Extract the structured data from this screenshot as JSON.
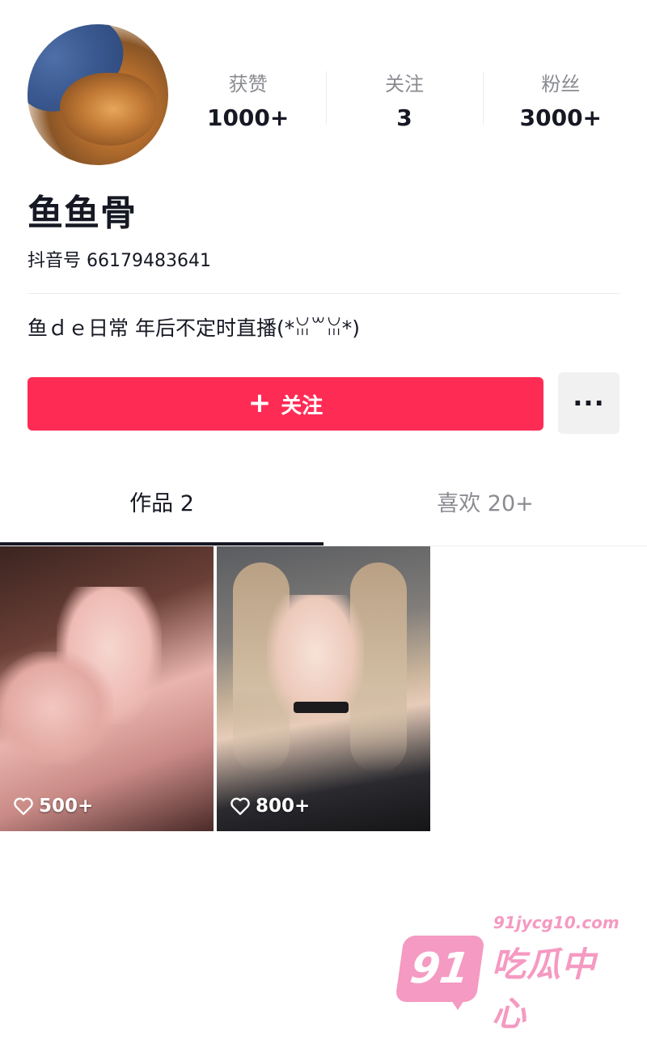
{
  "profile": {
    "nickname": "鱼鱼骨",
    "douyin_id": "抖音号 66179483641",
    "bio": "鱼ｄｅ日常 年后不定时直播(*ꈍ꒳ꈍ*)"
  },
  "stats": [
    {
      "label": "获赞",
      "value": "1000+"
    },
    {
      "label": "关注",
      "value": "3"
    },
    {
      "label": "粉丝",
      "value": "3000+"
    }
  ],
  "actions": {
    "follow_label": "关注",
    "follow_icon": "+",
    "more_icon": "···"
  },
  "tabs": [
    {
      "label": "作品 2",
      "active": true
    },
    {
      "label": "喜欢 20+",
      "active": false
    }
  ],
  "videos": [
    {
      "likes": "500+"
    },
    {
      "likes": "800+"
    }
  ],
  "watermark": {
    "badge": "91",
    "url": "91jycg10.com",
    "name": "吃瓜中心"
  },
  "colors": {
    "accent": "#fe2c55",
    "watermark": "#f59ac2"
  }
}
